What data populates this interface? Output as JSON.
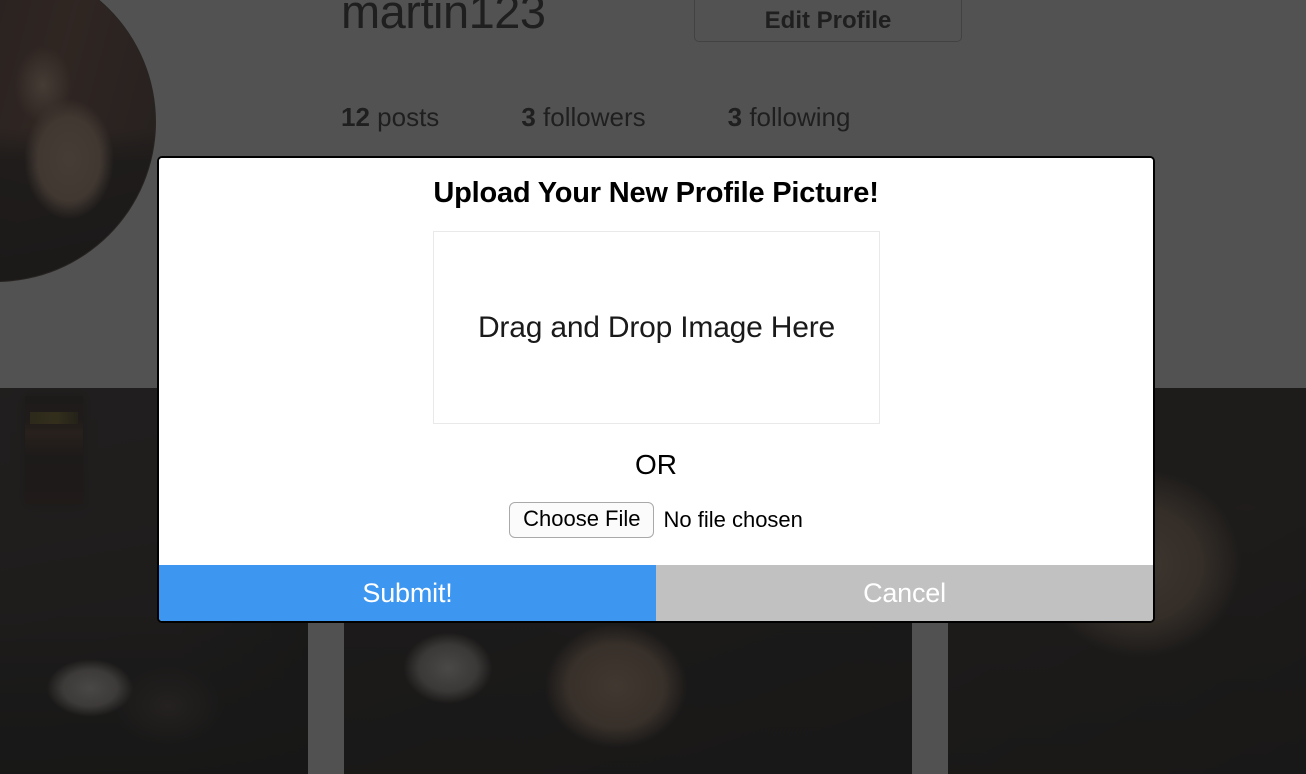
{
  "profile": {
    "username": "martin123",
    "edit_profile_label": "Edit Profile",
    "avatar_name": "profile-avatar",
    "stats": [
      {
        "value": "12",
        "label": "posts"
      },
      {
        "value": "3",
        "label": "followers"
      },
      {
        "value": "3",
        "label": "following"
      }
    ],
    "photos": [
      {
        "alt": "record sleeve and laptop in dark room"
      },
      {
        "alt": "man smiling next to a dog"
      },
      {
        "alt": "close up of a woman's face"
      }
    ]
  },
  "modal": {
    "title": "Upload Your New Profile Picture!",
    "drop_zone_label": "Drag and Drop Image Here",
    "or_label": "OR",
    "choose_file_label": "Choose File",
    "no_file_chosen_label": "No file chosen",
    "submit_label": "Submit!",
    "cancel_label": "Cancel"
  },
  "colors": {
    "submit": "#3d96f0",
    "cancel": "#c1c1c1",
    "modal_border": "#000000",
    "drop_zone_border": "#e9e9e9",
    "overlay": "rgba(30,30,30,0.77)"
  }
}
